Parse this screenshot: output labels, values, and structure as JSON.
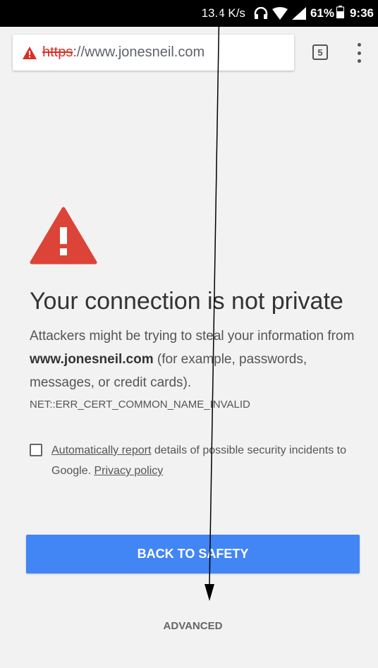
{
  "status_bar": {
    "net_speed": "13.4 K/s",
    "battery_percent": "61%",
    "time": "9:36",
    "icons": [
      "headphones-icon",
      "wifi-icon",
      "signal-icon",
      "battery-icon"
    ]
  },
  "toolbar": {
    "url_scheme": "https",
    "url_rest": "://www.jonesneil.com",
    "tab_count": "5",
    "security_icon": "warning-triangle-icon",
    "menu_icon": "overflow-menu-icon"
  },
  "interstitial": {
    "heading": "Your connection is not private",
    "explanation_prefix": "Attackers might be trying to steal your information from ",
    "site": "www.jonesneil.com",
    "explanation_suffix": " (for example, passwords, messages, or credit cards).",
    "error_code": "NET::ERR_CERT_COMMON_NAME_INVALID",
    "report_link": "Automatically report",
    "report_text": " details of possible security incidents to Google. ",
    "privacy_link": "Privacy policy",
    "primary_button": "BACK TO SAFETY",
    "secondary_button": "ADVANCED"
  },
  "colors": {
    "warning_red": "#db4437",
    "primary_blue": "#4285f4",
    "page_bg": "#f2f2f2"
  }
}
